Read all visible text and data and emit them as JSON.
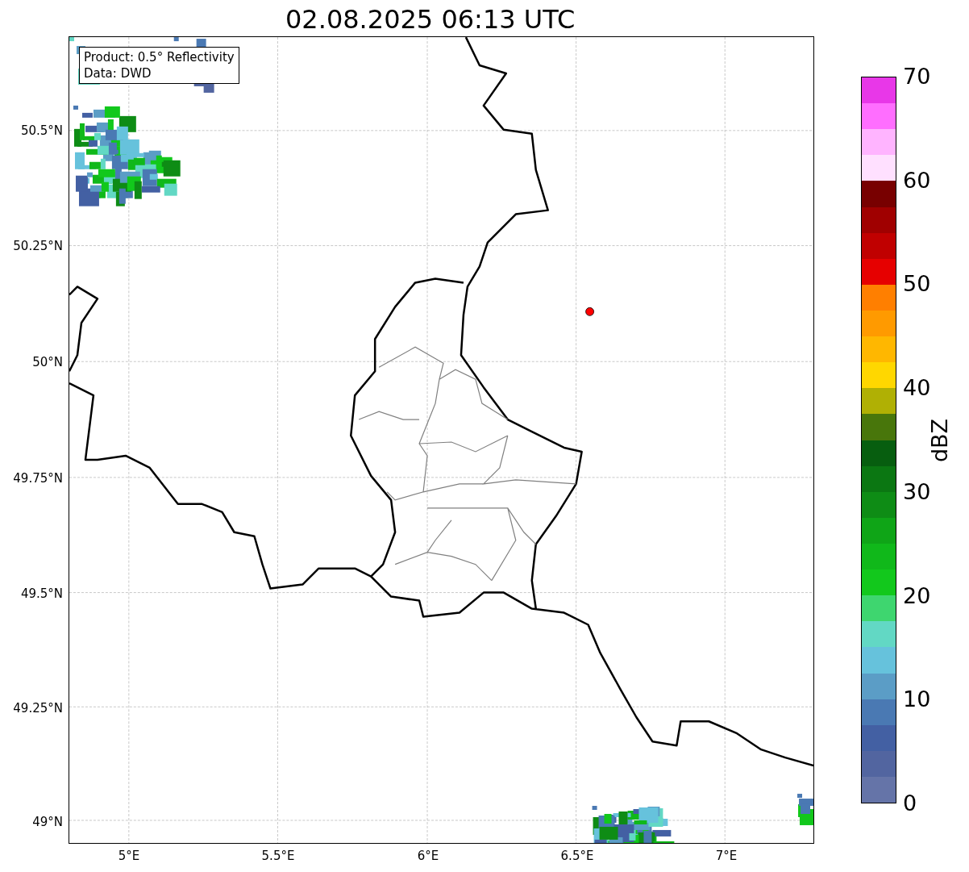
{
  "title": "02.08.2025 06:13 UTC",
  "legend": [
    "Product: 0.5° Reflectivity",
    "Data: DWD"
  ],
  "lat_ticks": [
    "50.5°N",
    "50.25°N",
    "50°N",
    "49.75°N",
    "49.5°N",
    "49.25°N",
    "49°N"
  ],
  "lon_ticks": [
    "5°E",
    "5.5°E",
    "6°E",
    "6.5°E",
    "7°E"
  ],
  "colorbar": {
    "label": "dBZ",
    "ticks": [
      "70",
      "60",
      "50",
      "40",
      "30",
      "20",
      "10",
      "0"
    ],
    "bins": [
      {
        "color": "#e837e8"
      },
      {
        "color": "#ff6eff"
      },
      {
        "color": "#ffb4ff"
      },
      {
        "color": "#ffe0ff"
      },
      {
        "color": "#780000"
      },
      {
        "color": "#a00000"
      },
      {
        "color": "#c00000"
      },
      {
        "color": "#e60000"
      },
      {
        "color": "#ff7f00"
      },
      {
        "color": "#ff9a00"
      },
      {
        "color": "#ffb700"
      },
      {
        "color": "#ffd700"
      },
      {
        "color": "#b0b004"
      },
      {
        "color": "#48760b"
      },
      {
        "color": "#075e0f"
      },
      {
        "color": "#0b7712"
      },
      {
        "color": "#0e8c15"
      },
      {
        "color": "#0fa517"
      },
      {
        "color": "#10b81a"
      },
      {
        "color": "#12c81c"
      },
      {
        "color": "#3ed66f"
      },
      {
        "color": "#62d8c4"
      },
      {
        "color": "#66c2dc"
      },
      {
        "color": "#5b9dc6"
      },
      {
        "color": "#4a79b3"
      },
      {
        "color": "#4360a3"
      },
      {
        "color": "#5265a0"
      },
      {
        "color": "#6574a8"
      }
    ]
  }
}
